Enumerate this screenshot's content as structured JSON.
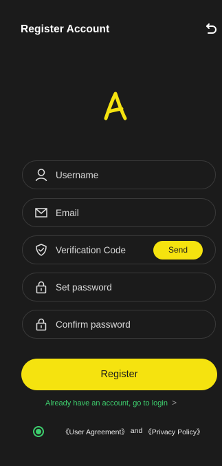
{
  "header": {
    "title": "Register Account"
  },
  "logo": {
    "letter": "A",
    "color": "#f5e30f"
  },
  "form": {
    "username_placeholder": "Username",
    "email_placeholder": "Email",
    "verification_placeholder": "Verification Code",
    "send_label": "Send",
    "password_placeholder": "Set password",
    "confirm_password_placeholder": "Confirm password"
  },
  "register_label": "Register",
  "login_link": {
    "text": "Already have an account, go to login",
    "chevron": ">"
  },
  "agreement": {
    "checked": true,
    "user_agreement": "《User Agreement》",
    "and": " and ",
    "privacy_policy": "《Privacy Policy》"
  },
  "colors": {
    "background": "#1b1b1b",
    "accent": "#f5e30f",
    "link": "#3ecf6e",
    "field_border": "#3a3a3a"
  }
}
